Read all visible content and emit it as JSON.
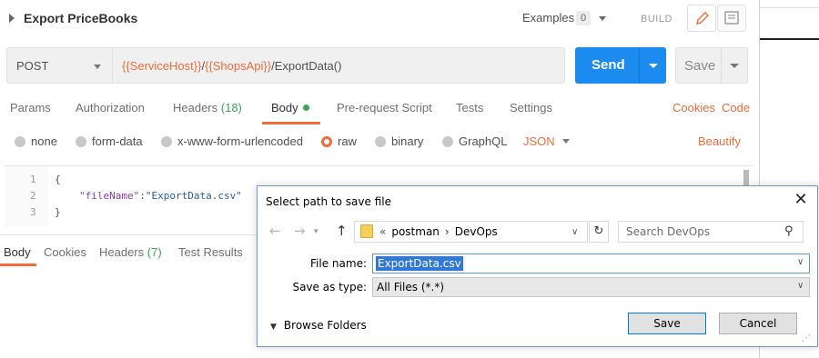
{
  "header": {
    "title": "Export PriceBooks",
    "examples_label": "Examples",
    "examples_count": "0",
    "build_label": "BUILD"
  },
  "request": {
    "method": "POST",
    "url_parts": [
      {
        "text": "{{ServiceHost}}",
        "kind": "variable"
      },
      {
        "text": "/",
        "kind": "plain"
      },
      {
        "text": "{{ShopsApi}}",
        "kind": "variable"
      },
      {
        "text": "/ExportData()",
        "kind": "plain"
      }
    ],
    "send_label": "Send",
    "save_label": "Save"
  },
  "request_tabs": {
    "params": "Params",
    "authorization": "Authorization",
    "headers": "Headers",
    "headers_count": "(18)",
    "body": "Body",
    "pre_request": "Pre-request Script",
    "tests": "Tests",
    "settings": "Settings",
    "cookies": "Cookies",
    "code": "Code"
  },
  "body_types": {
    "none": "none",
    "form_data": "form-data",
    "urlencoded": "x-www-form-urlencoded",
    "raw": "raw",
    "binary": "binary",
    "graphql": "GraphQL",
    "format": "JSON",
    "beautify": "Beautify",
    "selected": "raw"
  },
  "editor": {
    "line_numbers": [
      "1",
      "2",
      "3"
    ],
    "line1": "{",
    "line2_key": "\"fileName\"",
    "line2_colon": ":",
    "line2_value": "\"ExportData.csv\"",
    "line3": "}"
  },
  "response_tabs": {
    "body": "Body",
    "cookies": "Cookies",
    "headers": "Headers",
    "headers_count": "(7)",
    "test_results": "Test Results"
  },
  "dialog": {
    "title": "Select path to save file",
    "close": "✕",
    "breadcrumb_prefix": "«",
    "path": [
      "postman",
      "DevOps"
    ],
    "search_placeholder": "Search DevOps",
    "file_name_label": "File name:",
    "file_name_value": "ExportData.csv",
    "save_as_type_label": "Save as type:",
    "save_as_type_value": "All Files (*.*)",
    "browse_folders": "Browse Folders",
    "save_button": "Save",
    "cancel_button": "Cancel"
  },
  "colors": {
    "accent_orange": "#f26b3a",
    "send_blue": "#1c8bf0",
    "count_green": "#3aa757",
    "selection_blue": "#3079d8"
  }
}
